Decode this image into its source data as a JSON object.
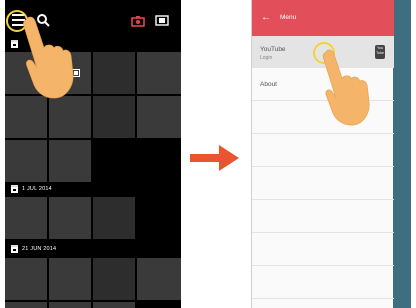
{
  "left_screen": {
    "sections": [
      {
        "date": "1 JUL 2014"
      },
      {
        "date": "21 JUN 2014"
      }
    ]
  },
  "right_screen": {
    "toolbar_title": "Menu",
    "items": [
      {
        "label": "YouTube",
        "sub": "Login",
        "icon": "youtube-icon"
      },
      {
        "label": "About",
        "sub": ""
      }
    ],
    "colors": {
      "toolbar": "#e24f5a",
      "arrow": "#e9552f",
      "highlight_ring": "#f5d23a",
      "hand": "#f4b56a"
    }
  }
}
